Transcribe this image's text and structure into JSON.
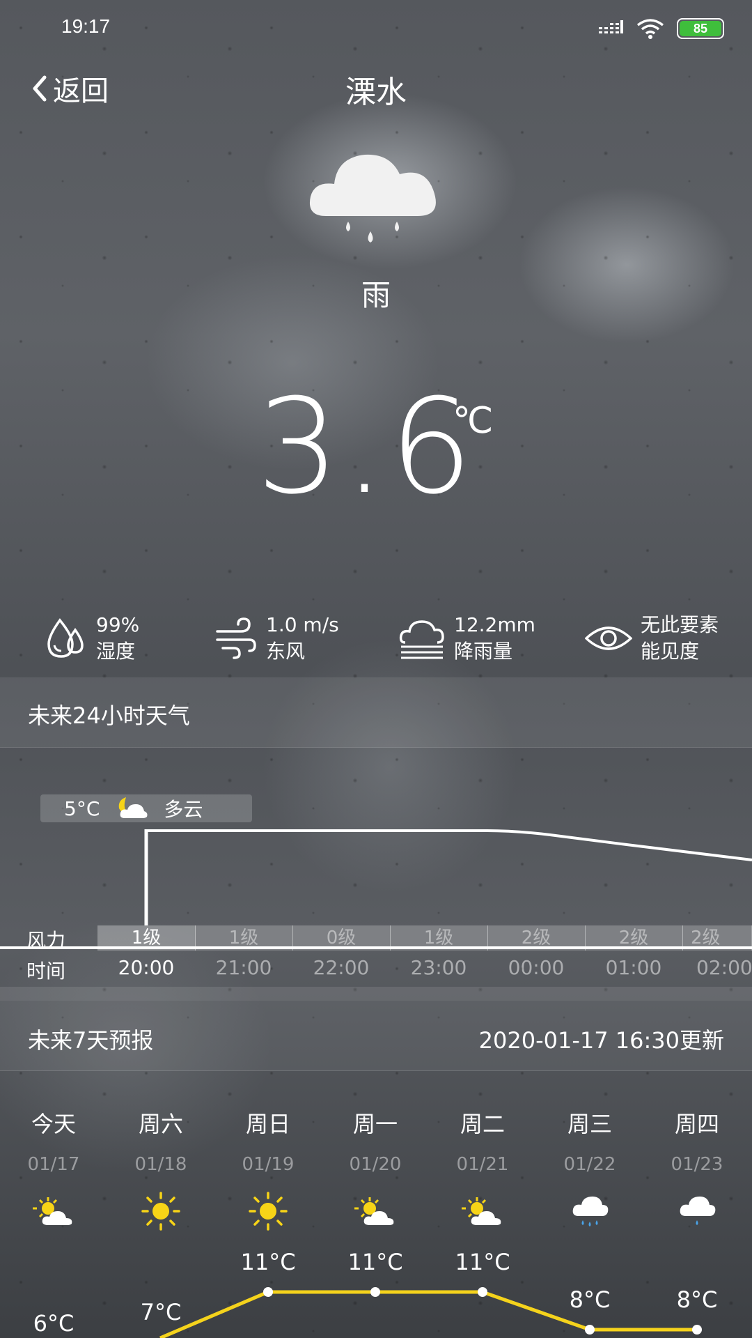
{
  "status_bar": {
    "time": "19:17",
    "battery": "85"
  },
  "header": {
    "back_label": "返回",
    "city": "溧水"
  },
  "current": {
    "condition": "雨",
    "temperature": "3.6",
    "unit": "℃"
  },
  "metrics": [
    {
      "icon": "humidity-icon",
      "value": "99%",
      "label": "湿度"
    },
    {
      "icon": "wind-icon",
      "value": "1.0 m/s",
      "label": "东风"
    },
    {
      "icon": "precipitation-icon",
      "value": "12.2mm",
      "label": "降雨量"
    },
    {
      "icon": "visibility-icon",
      "value": "无此要素",
      "label": "能见度"
    }
  ],
  "hourly": {
    "title": "未来24小时天气",
    "tooltip": {
      "temp": "5°C",
      "condition": "多云"
    },
    "wind_label": "风力",
    "time_label": "时间",
    "wind": [
      "1级",
      "1级",
      "0级",
      "1级",
      "2级",
      "2级",
      "2级"
    ],
    "times": [
      "20:00",
      "21:00",
      "22:00",
      "23:00",
      "00:00",
      "01:00",
      "02:00"
    ]
  },
  "daily": {
    "title": "未来7天预报",
    "updated": "2020-01-17 16:30更新",
    "days": [
      {
        "name": "今天",
        "date": "01/17",
        "icon": "partly-sunny-icon",
        "high": "6°C"
      },
      {
        "name": "周六",
        "date": "01/18",
        "icon": "sunny-icon",
        "high": "7°C"
      },
      {
        "name": "周日",
        "date": "01/19",
        "icon": "sunny-icon",
        "high": "11°C"
      },
      {
        "name": "周一",
        "date": "01/20",
        "icon": "partly-sunny-icon",
        "high": "11°C"
      },
      {
        "name": "周二",
        "date": "01/21",
        "icon": "partly-sunny-icon",
        "high": "11°C"
      },
      {
        "name": "周三",
        "date": "01/22",
        "icon": "rain-icon",
        "high": "8°C"
      },
      {
        "name": "周四",
        "date": "01/23",
        "icon": "rain-icon",
        "high": "8°C"
      }
    ]
  },
  "colors": {
    "accent_line": "#f5d31c",
    "sun": "#f7d417",
    "battery": "#3fbe3c"
  }
}
